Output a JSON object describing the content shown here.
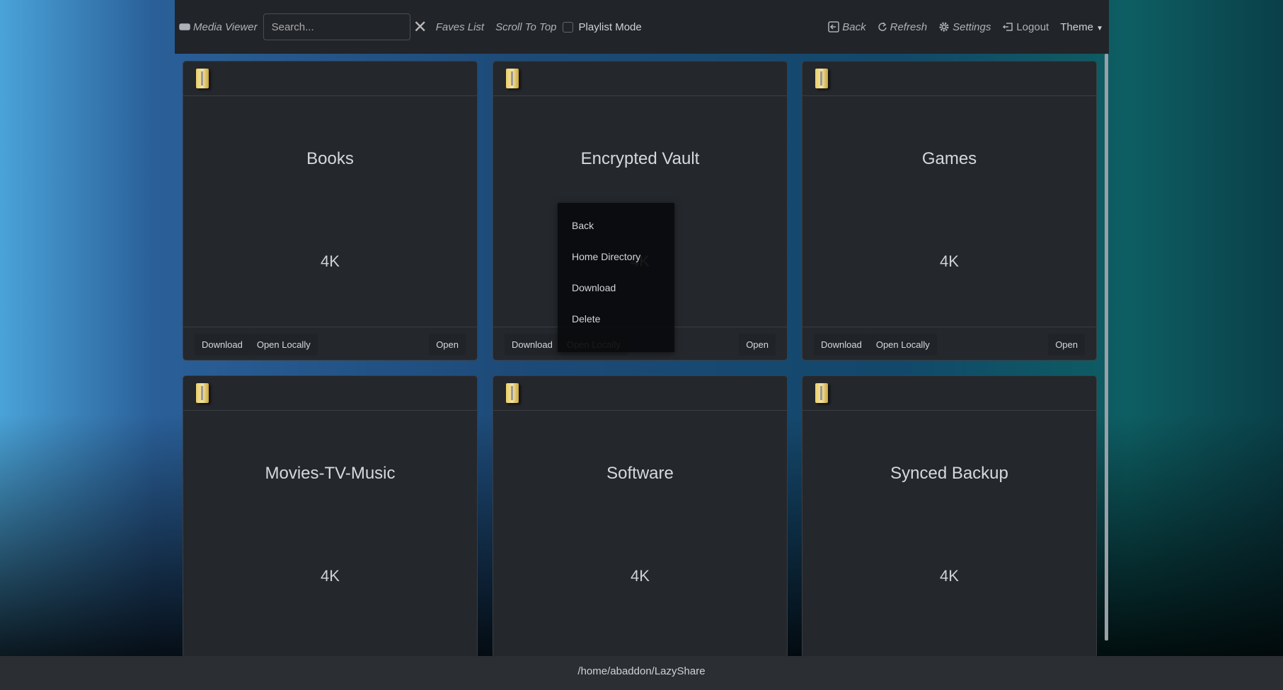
{
  "nav": {
    "brand": "Media Viewer",
    "search_placeholder": "Search...",
    "faves": "Faves List",
    "scroll_top": "Scroll To Top",
    "playlist_mode": "Playlist Mode",
    "back": "Back",
    "refresh": "Refresh",
    "settings": "Settings",
    "logout": "Logout",
    "theme": "Theme"
  },
  "cards": [
    {
      "title": "Books",
      "size": "4K",
      "download": "Download",
      "open_locally": "Open Locally",
      "open": "Open"
    },
    {
      "title": "Encrypted Vault",
      "size": "4K",
      "download": "Download",
      "open_locally": "Open Locally",
      "open": "Open"
    },
    {
      "title": "Games",
      "size": "4K",
      "download": "Download",
      "open_locally": "Open Locally",
      "open": "Open"
    },
    {
      "title": "Movies-TV-Music",
      "size": "4K"
    },
    {
      "title": "Software",
      "size": "4K"
    },
    {
      "title": "Synced Backup",
      "size": "4K"
    }
  ],
  "context_menu": [
    "Back",
    "Home Directory",
    "Download",
    "Delete"
  ],
  "footer": {
    "path": "/home/abaddon/LazyShare"
  }
}
